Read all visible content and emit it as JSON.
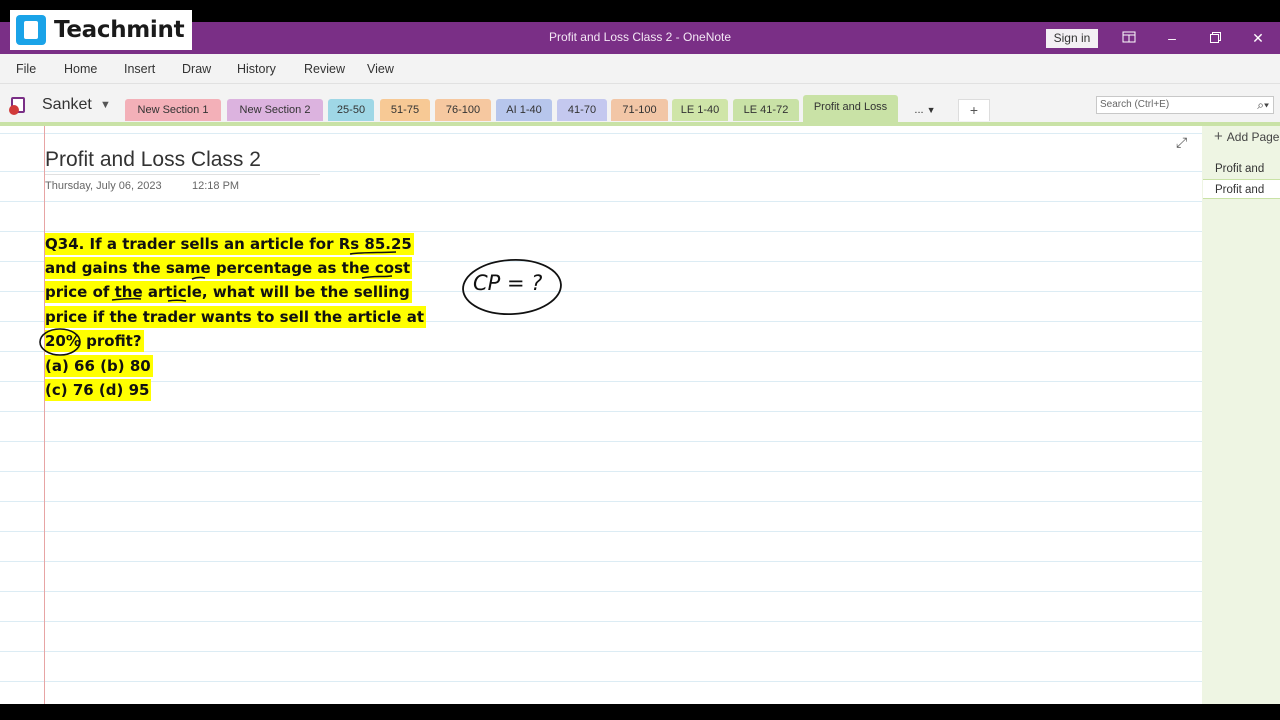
{
  "brand": {
    "name": "Teachmint"
  },
  "window": {
    "title": "Profit and Loss Class 2  -  OneNote",
    "signin_label": "Sign in"
  },
  "ribbon": {
    "tabs": [
      "File",
      "Home",
      "Insert",
      "Draw",
      "History",
      "Review",
      "View"
    ]
  },
  "notebook": {
    "name": "Sanket"
  },
  "sections": [
    {
      "label": "New Section 1",
      "color": "#f3b0b8"
    },
    {
      "label": "New Section 2",
      "color": "#dcb3df"
    },
    {
      "label": "25-50",
      "color": "#9fd7e6"
    },
    {
      "label": "51-75",
      "color": "#f7c995"
    },
    {
      "label": "76-100",
      "color": "#f6c8a0"
    },
    {
      "label": "AI 1-40",
      "color": "#b7c6ec"
    },
    {
      "label": "41-70",
      "color": "#c4c8ef"
    },
    {
      "label": "71-100",
      "color": "#f2c6a6"
    },
    {
      "label": "LE 1-40",
      "color": "#cfe5a8"
    },
    {
      "label": "LE 41-72",
      "color": "#c9e2a6"
    },
    {
      "label": "Profit and Loss",
      "color": "#c9e2a6",
      "active": true
    }
  ],
  "section_more": "...",
  "search": {
    "placeholder": "Search (Ctrl+E)"
  },
  "page": {
    "title": "Profit and Loss Class 2",
    "date": "Thursday, July 06, 2023",
    "time": "12:18 PM",
    "question_lines": [
      "Q34. If a trader sells an article for Rs 85.25",
      "and gains the same percentage as the cost",
      "price of the article, what will be the selling",
      "price if the trader wants to sell the article at",
      "20% profit?",
      "(a) 66 (b) 80",
      "(c) 76 (d) 95"
    ],
    "handwriting": "CP = ?"
  },
  "pages_panel": {
    "add_label": "Add Page",
    "pages": [
      "Profit and",
      "Profit and"
    ]
  },
  "colors": {
    "titlebar": "#7a2f86",
    "highlight": "#ffff00",
    "active_section": "#c9e2a6"
  }
}
